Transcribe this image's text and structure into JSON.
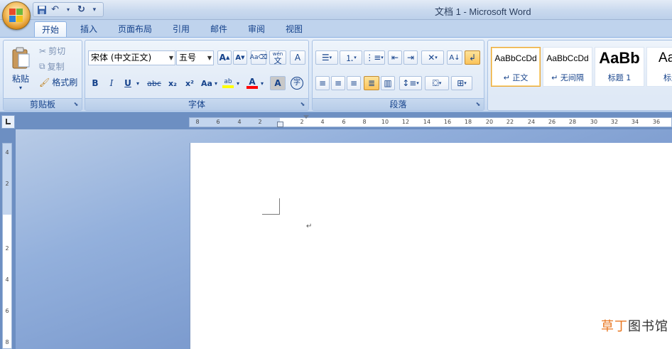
{
  "window": {
    "title": "文档 1 - Microsoft Word"
  },
  "quick_access": {
    "save_icon": "save-icon",
    "undo_icon": "undo-icon",
    "redo_icon": "redo-icon",
    "customize_icon": "customize-qat-icon"
  },
  "tabs": [
    {
      "label": "开始",
      "active": true
    },
    {
      "label": "插入"
    },
    {
      "label": "页面布局"
    },
    {
      "label": "引用"
    },
    {
      "label": "邮件"
    },
    {
      "label": "审阅"
    },
    {
      "label": "视图"
    }
  ],
  "clipboard": {
    "label": "剪贴板",
    "paste": "粘贴",
    "cut": "剪切",
    "copy": "复制",
    "format_painter": "格式刷"
  },
  "font": {
    "label": "字体",
    "font_name": "宋体 (中文正文)",
    "font_size": "五号",
    "grow": "A",
    "shrink": "A",
    "bold": "B",
    "italic": "I",
    "underline": "U",
    "strike": "abc",
    "subscript": "x₂",
    "superscript": "x²",
    "change_case": "Aa",
    "highlight": "ab",
    "font_color": "A",
    "char_shading": "A",
    "enclose": "字",
    "phonetic": "wén",
    "phonetic_char": "文",
    "char_border": "A"
  },
  "paragraph": {
    "label": "段落"
  },
  "styles": {
    "tiles": [
      {
        "sample": "AaBbCcDd",
        "name": "↵ 正文",
        "selected": true
      },
      {
        "sample": "AaBbCcDd",
        "name": "↵ 无间隔"
      },
      {
        "sample": "AaBb",
        "name": "标题 1"
      },
      {
        "sample": "AaB",
        "name": "标题"
      }
    ]
  },
  "ruler": {
    "h_ticks": [
      "8",
      "6",
      "4",
      "2",
      "2",
      "4",
      "6",
      "8",
      "10",
      "12",
      "14",
      "16",
      "18",
      "20",
      "22",
      "24",
      "26",
      "28",
      "30",
      "32",
      "34",
      "36"
    ],
    "v_ticks": [
      "4",
      "2",
      "2",
      "4",
      "6",
      "8"
    ]
  },
  "document": {
    "para_mark": "↵"
  },
  "watermark": {
    "part1": "草丁",
    "part2": "图书馆"
  },
  "colors": {
    "accent": "#15428b",
    "ribbon": "#dfe9f6",
    "highlight": "#ffff00",
    "font_color": "#ff0000"
  }
}
